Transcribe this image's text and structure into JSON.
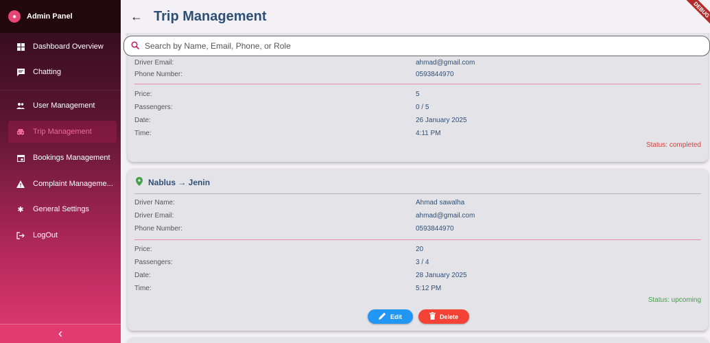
{
  "sidebar": {
    "title": "Admin Panel",
    "items": [
      {
        "label": "Dashboard Overview",
        "icon": "dashboard-icon"
      },
      {
        "label": "Chatting",
        "icon": "chat-icon"
      },
      {
        "label": "User Management",
        "icon": "people-icon"
      },
      {
        "label": "Trip Management",
        "icon": "car-icon"
      },
      {
        "label": "Bookings Management",
        "icon": "calendar-icon"
      },
      {
        "label": "Complaint Manageme...",
        "icon": "warning-icon"
      },
      {
        "label": "General Settings",
        "icon": "settings-icon"
      },
      {
        "label": "LogOut",
        "icon": "logout-icon"
      }
    ],
    "collapse_icon": "chevron-left-icon"
  },
  "header": {
    "title": "Trip Management",
    "debug_banner": "DEBUG"
  },
  "search": {
    "placeholder": "Search by Name, Email, Phone, or Role"
  },
  "labels": {
    "driver_email": "Driver Email:",
    "phone_number": "Phone Number:",
    "driver_name": "Driver Name:",
    "price": "Price:",
    "passengers": "Passengers:",
    "date": "Date:",
    "time": "Time:"
  },
  "trips": [
    {
      "driver_email": "ahmad@gmail.com",
      "phone": "0593844970",
      "price": "5",
      "passengers": "0 / 5",
      "date": "26 January 2025",
      "time": "4:11 PM",
      "status": "Status: completed"
    },
    {
      "route": "Nablus → Jenin",
      "driver_name": "Ahmad sawalha",
      "driver_email": "ahmad@gmail.com",
      "phone": "0593844970",
      "price": "20",
      "passengers": "3 / 4",
      "date": "28 January 2025",
      "time": "5:12 PM",
      "status": "Status: upcoming",
      "edit_label": "Edit",
      "delete_label": "Delete"
    }
  ],
  "colors": {
    "accent": "#e23b72",
    "title_blue": "#2e5077",
    "completed": "#e53935",
    "upcoming": "#43a047",
    "edit": "#2196f3",
    "delete": "#f44336"
  }
}
